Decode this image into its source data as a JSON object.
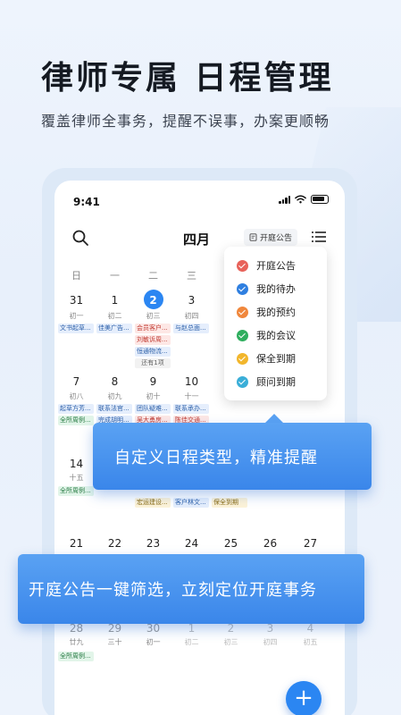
{
  "hero": {
    "title": "律师专属  日程管理",
    "subtitle": "覆盖律师全事务，提醒不误事，办案更顺畅"
  },
  "status": {
    "time": "9:41"
  },
  "calendar": {
    "month": "四月",
    "notice_chip": "开庭公告",
    "weekdays": [
      "日",
      "一",
      "二",
      "三"
    ],
    "week1": [
      {
        "d": "31",
        "l": "初一"
      },
      {
        "d": "1",
        "l": "初二"
      },
      {
        "d": "2",
        "l": "初三"
      },
      {
        "d": "3",
        "l": "初四"
      }
    ],
    "week2": [
      {
        "d": "7",
        "l": "初八"
      },
      {
        "d": "8",
        "l": "初九"
      },
      {
        "d": "9",
        "l": "初十"
      },
      {
        "d": "10",
        "l": "十一"
      }
    ],
    "week3": [
      {
        "d": "14",
        "l": "十五"
      }
    ],
    "week4": [
      "21",
      "22",
      "23",
      "24",
      "25",
      "26",
      "27"
    ],
    "week5": [
      {
        "d": "28",
        "l": "廿九"
      },
      {
        "d": "29",
        "l": "三十"
      },
      {
        "d": "30",
        "l": "初一"
      },
      {
        "d": "1",
        "l": "初二"
      },
      {
        "d": "2",
        "l": "初三"
      },
      {
        "d": "3",
        "l": "初四"
      },
      {
        "d": "4",
        "l": "初五"
      }
    ],
    "events": {
      "w1_sun": "文书起草...",
      "w1_mon": "佳美广告...",
      "w1_tue_1": "会员客户...",
      "w1_tue_2": "刘敏诉周...",
      "w1_tue_3": "恒通物流...",
      "w1_tue_more": "还有1项",
      "w1_wed": "与赵总面...",
      "w2_sun_1": "起草方芳...",
      "w2_sun_2": "全所周例...",
      "w2_mon_1": "联系法官...",
      "w2_mon_2": "完成胡明...",
      "w2_tue_1": "团队疑难...",
      "w2_tue_2": "吴大勇房...",
      "w2_wed_1": "联系承办...",
      "w2_wed_2": "陈佳交通...",
      "w3_sun": "全所周例...",
      "w3_tue": "宏运建设...",
      "w3_wed_1": "客户林文...",
      "w3_wed_2": "保全到期",
      "w5_sun": "全所周例..."
    }
  },
  "dropdown": {
    "items": [
      {
        "label": "开庭公告",
        "color": "#e8625a"
      },
      {
        "label": "我的待办",
        "color": "#2f7fe0"
      },
      {
        "label": "我的预约",
        "color": "#f0873c"
      },
      {
        "label": "我的会议",
        "color": "#2fae5e"
      },
      {
        "label": "保全到期",
        "color": "#f2b62c"
      },
      {
        "label": "顾问到期",
        "color": "#3aaed8"
      }
    ]
  },
  "callouts": {
    "first": "自定义日程类型，精准提醒",
    "second": "开庭公告一键筛选，立刻定位开庭事务"
  },
  "fab": {
    "label": "+"
  }
}
